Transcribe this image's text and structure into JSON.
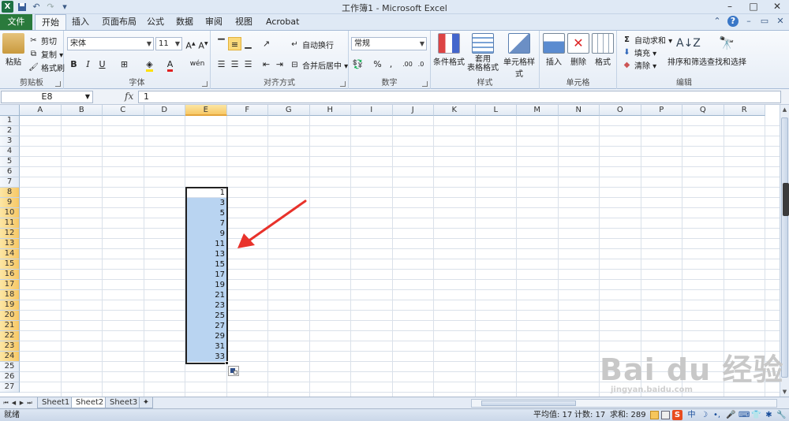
{
  "window": {
    "title": "工作簿1 - Microsoft Excel",
    "app_logo": "X"
  },
  "tabs": [
    {
      "label": "文件"
    },
    {
      "label": "开始"
    },
    {
      "label": "插入"
    },
    {
      "label": "页面布局"
    },
    {
      "label": "公式"
    },
    {
      "label": "数据"
    },
    {
      "label": "审阅"
    },
    {
      "label": "视图"
    },
    {
      "label": "Acrobat"
    }
  ],
  "ribbon": {
    "clipboard": {
      "label": "剪贴板",
      "paste": "粘贴",
      "cut": "剪切",
      "copy": "复制 ▾",
      "format_painter": "格式刷"
    },
    "font": {
      "label": "字体",
      "name": "宋体",
      "size": "11",
      "bold": "B",
      "italic": "I",
      "underline": "U",
      "phonetic": "wén"
    },
    "alignment": {
      "label": "对齐方式",
      "wrap": "自动换行",
      "merge": "合并后居中 ▾"
    },
    "number": {
      "label": "数字",
      "format": "常规",
      "percent": "%",
      "comma": ","
    },
    "styles": {
      "label": "样式",
      "conditional": "条件格式",
      "table_line1": "套用",
      "table_line2": "表格格式",
      "cell_styles": "单元格样式"
    },
    "cells": {
      "label": "单元格",
      "insert": "插入",
      "delete": "删除",
      "format": "格式"
    },
    "editing": {
      "label": "编辑",
      "autosum": "自动求和 ▾",
      "fill": "填充 ▾",
      "clear": "清除 ▾",
      "sort": "排序和筛选",
      "find": "查找和选择"
    }
  },
  "formula_bar": {
    "name_box": "E8",
    "fx": "fx",
    "value": "1"
  },
  "columns": [
    "A",
    "B",
    "C",
    "D",
    "E",
    "F",
    "G",
    "H",
    "I",
    "J",
    "K",
    "L",
    "M",
    "N",
    "O",
    "P",
    "Q",
    "R"
  ],
  "selected_column": "E",
  "rows": [
    "1",
    "2",
    "3",
    "4",
    "5",
    "6",
    "7",
    "8",
    "9",
    "10",
    "11",
    "12",
    "13",
    "14",
    "15",
    "16",
    "17",
    "18",
    "19",
    "20",
    "21",
    "22",
    "23",
    "24",
    "25",
    "26",
    "27"
  ],
  "selected_rows": [
    "8",
    "9",
    "10",
    "11",
    "12",
    "13",
    "14",
    "15",
    "16",
    "17",
    "18",
    "19",
    "20",
    "21",
    "22",
    "23",
    "24"
  ],
  "cells_E": [
    "1",
    "3",
    "5",
    "7",
    "9",
    "11",
    "13",
    "15",
    "17",
    "19",
    "21",
    "23",
    "25",
    "27",
    "29",
    "31",
    "33"
  ],
  "sheets": [
    "Sheet1",
    "Sheet2",
    "Sheet3"
  ],
  "active_sheet": "Sheet2",
  "status": {
    "ready": "就绪",
    "average": "平均值: 17",
    "count": "计数: 17",
    "sum": "求和: 289"
  },
  "tray": {
    "ime": "中",
    "sogou": "S"
  },
  "watermark": {
    "brand": "Bai du 经验",
    "url": "jingyan.baidu.com"
  },
  "colors": {
    "selection_fill": "#b9d4f1",
    "header_selected": "#f7c866",
    "file_tab": "#2a7a3c",
    "arrow": "#e8322b"
  }
}
